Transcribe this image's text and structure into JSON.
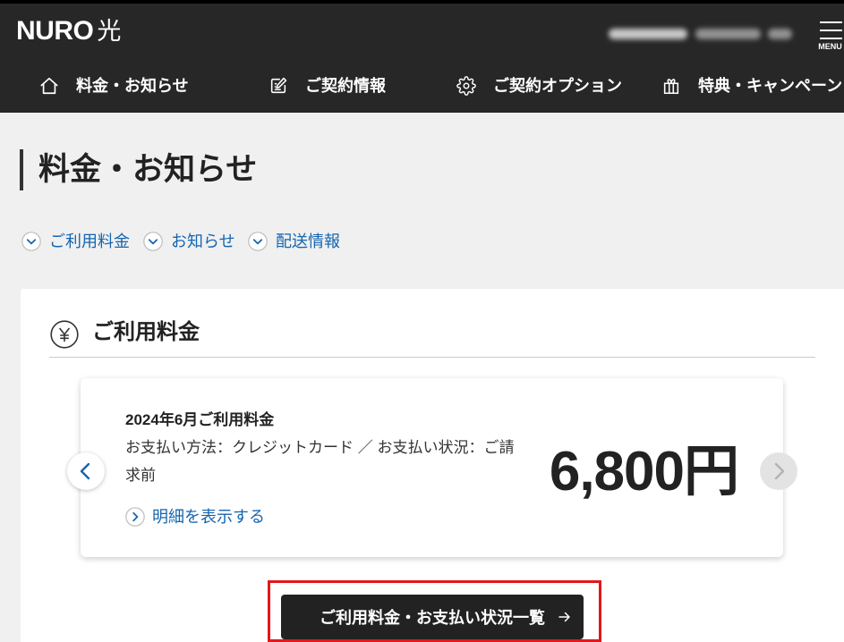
{
  "header": {
    "logo_latin": "NURO",
    "logo_kanji": "光",
    "menu_label": "MENU",
    "nav": [
      {
        "label": "料金・お知らせ",
        "icon": "home-icon"
      },
      {
        "label": "ご契約情報",
        "icon": "edit-document-icon"
      },
      {
        "label": "ご契約オプション",
        "icon": "gear-icon"
      },
      {
        "label": "特典・キャンペーン",
        "icon": "gift-icon"
      }
    ]
  },
  "page": {
    "title": "料金・お知らせ",
    "anchors": [
      {
        "label": "ご利用料金",
        "icon": "chevron-down-circle-icon"
      },
      {
        "label": "お知らせ",
        "icon": "chevron-down-circle-icon"
      },
      {
        "label": "配送情報",
        "icon": "chevron-down-circle-icon"
      }
    ]
  },
  "billing": {
    "heading": "ご利用料金",
    "heading_icon": "yen-circle-icon",
    "slide": {
      "month_title": "2024年6月ご利用料金",
      "payment_info": "お支払い方法：クレジットカード ／ お支払い状況：ご請求前",
      "amount": "6,800円",
      "detail_link": "明細を表示する",
      "detail_icon": "chevron-right-circle-icon"
    },
    "prev_icon": "chevron-left-icon",
    "next_icon": "chevron-right-icon",
    "list_button": "ご利用料金・お支払い状況一覧",
    "list_button_icon": "arrow-right-icon"
  },
  "colors": {
    "header_bg": "#272727",
    "page_bg": "#f0f0f0",
    "link": "#1565b0",
    "button_bg": "#222222",
    "highlight": "#e3171b",
    "text": "#222222"
  }
}
